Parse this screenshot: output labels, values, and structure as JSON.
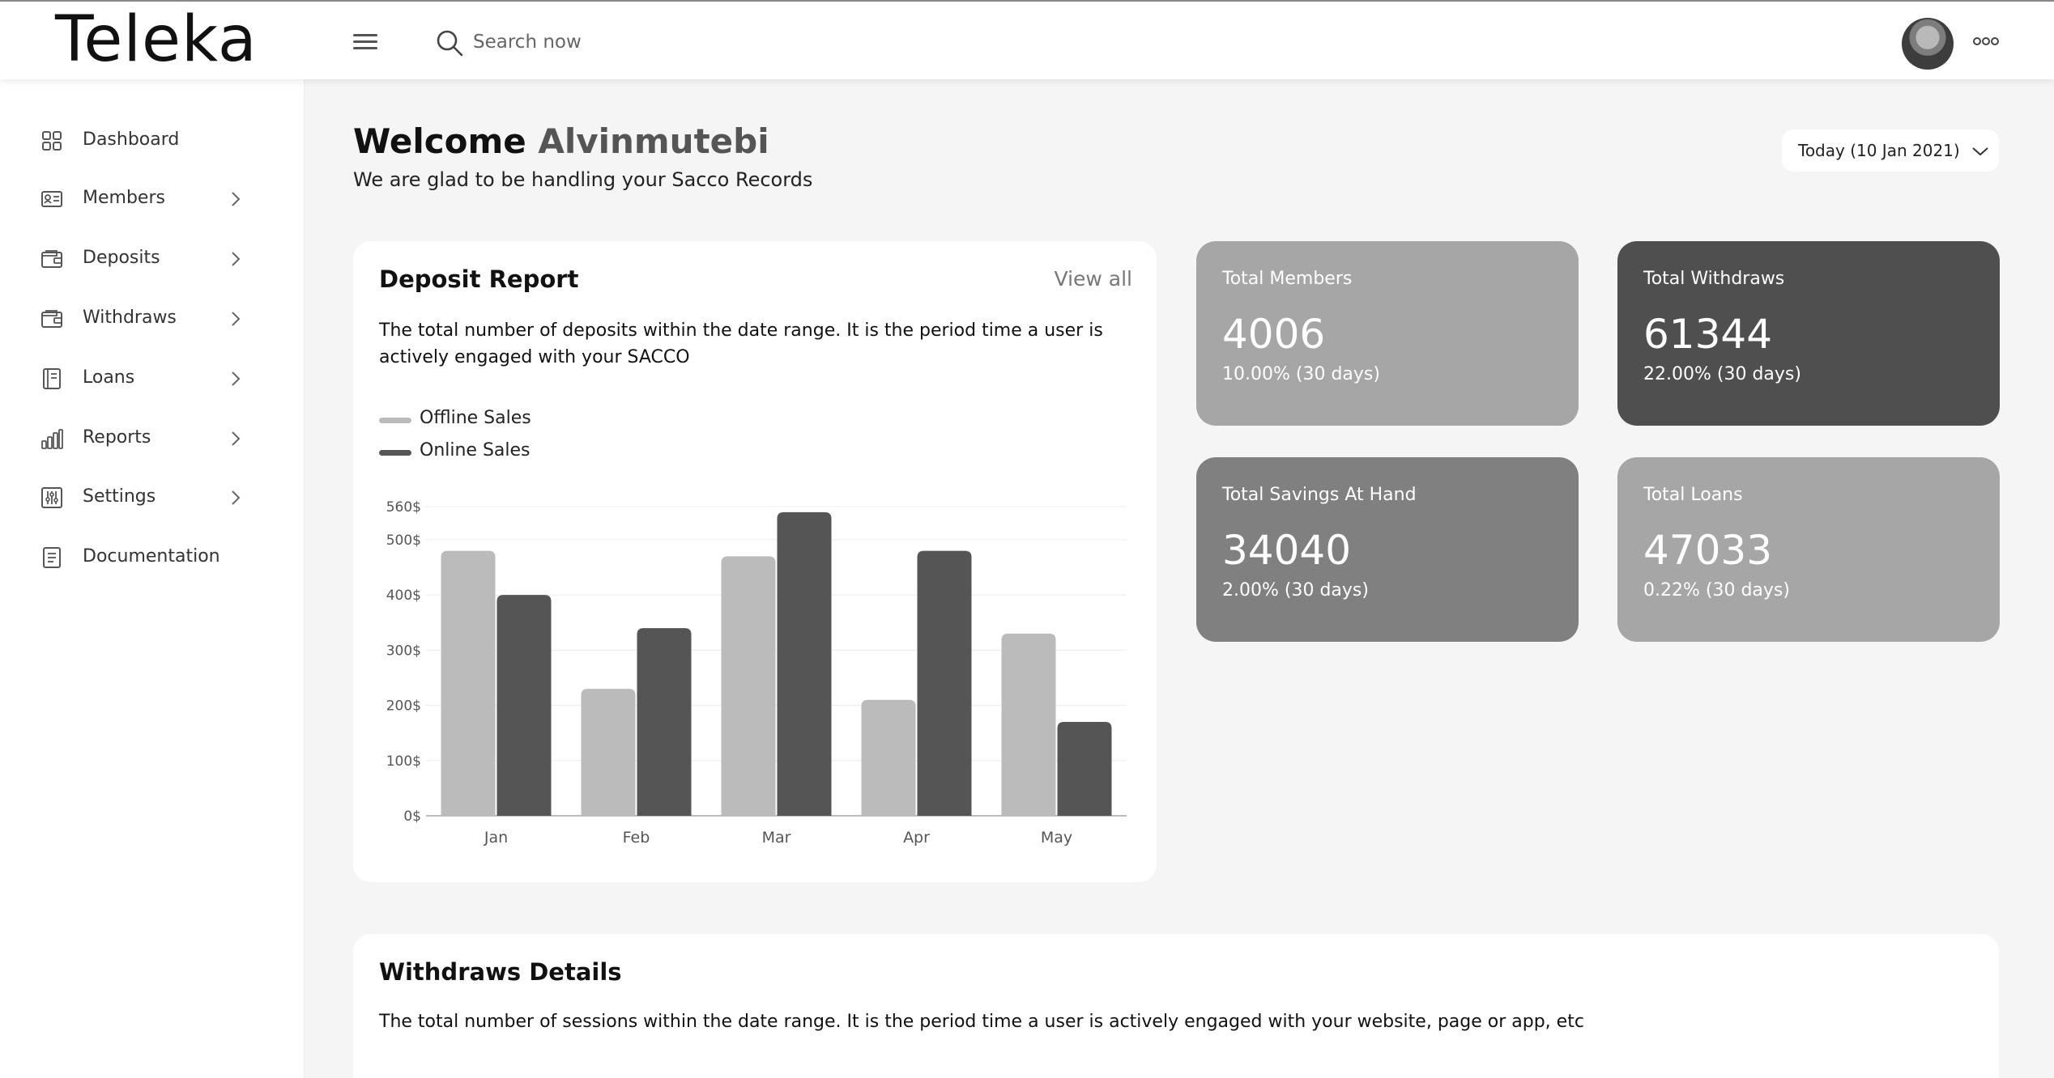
{
  "app": {
    "logo": "Teleka",
    "search_placeholder": "Search now"
  },
  "sidebar": {
    "items": [
      {
        "label": "Dashboard",
        "icon": "grid-icon"
      },
      {
        "label": "Members",
        "icon": "id-card-icon"
      },
      {
        "label": "Deposits",
        "icon": "wallet-icon"
      },
      {
        "label": "Withdraws",
        "icon": "wallet-icon"
      },
      {
        "label": "Loans",
        "icon": "ledger-icon"
      },
      {
        "label": "Reports",
        "icon": "bar-chart-icon"
      },
      {
        "label": "Settings",
        "icon": "sliders-icon"
      },
      {
        "label": "Documentation",
        "icon": "document-icon"
      }
    ]
  },
  "header": {
    "welcome": "Welcome",
    "username": "Alvinmutebi",
    "subtitle": "We are glad to be handling your Sacco Records",
    "date_filter": "Today (10 Jan 2021)"
  },
  "deposit_report": {
    "title": "Deposit Report",
    "view_all": "View all",
    "description": "The total number of deposits within the date range. It is the period time a user is actively engaged with your SACCO"
  },
  "chart_data": {
    "type": "bar",
    "categories": [
      "Jan",
      "Feb",
      "Mar",
      "Apr",
      "May"
    ],
    "series": [
      {
        "name": "Offline Sales",
        "color": "#bbbbbb",
        "values": [
          480,
          230,
          470,
          210,
          330
        ]
      },
      {
        "name": "Online Sales",
        "color": "#555555",
        "values": [
          400,
          340,
          550,
          480,
          170
        ]
      }
    ],
    "yticks": [
      "0$",
      "100$",
      "200$",
      "300$",
      "400$",
      "500$",
      "560$"
    ],
    "ytick_values": [
      0,
      100,
      200,
      300,
      400,
      500,
      560
    ],
    "ylim": [
      0,
      560
    ],
    "grid": true,
    "legend": "top-left"
  },
  "stats": [
    {
      "label": "Total Members",
      "value": "4006",
      "change": "10.00% (30 days)",
      "color": "#a6a6a6"
    },
    {
      "label": "Total Withdraws",
      "value": "61344",
      "change": "22.00% (30 days)",
      "color": "#4f4f4f"
    },
    {
      "label": "Total Savings At Hand",
      "value": "34040",
      "change": "2.00% (30 days)",
      "color": "#808080"
    },
    {
      "label": "Total Loans",
      "value": "47033",
      "change": "0.22% (30 days)",
      "color": "#a6a6a6"
    }
  ],
  "withdraws": {
    "title": "Withdraws Details",
    "description": "The total number of sessions within the date range. It is the period time a user is actively engaged with your website, page or app, etc"
  }
}
